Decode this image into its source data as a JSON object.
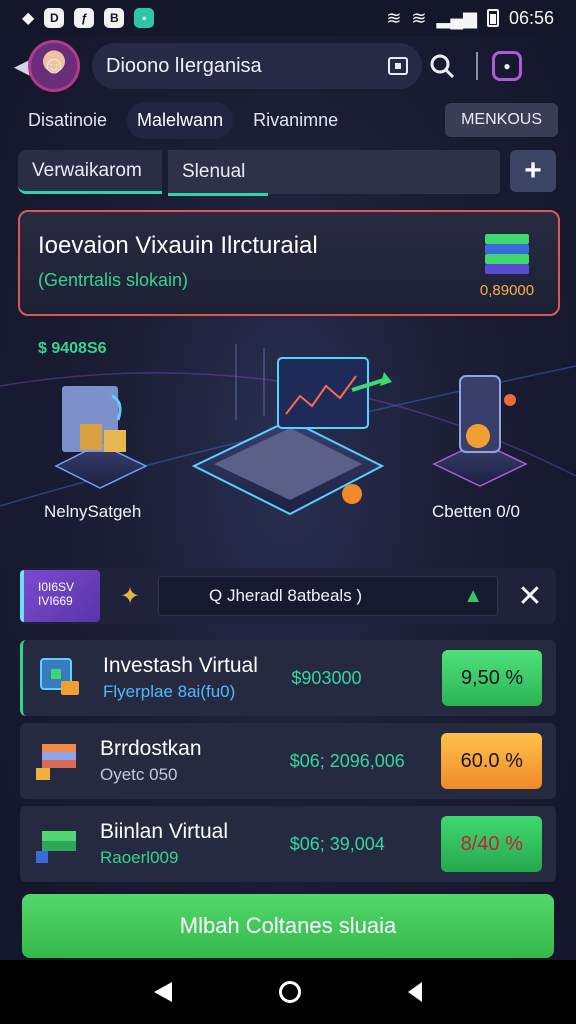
{
  "status_bar": {
    "time": "06:56",
    "icons": [
      "notification-icon",
      "app-icon-1",
      "app-icon-2",
      "app-icon-3",
      "gamepad-icon"
    ],
    "indicators": [
      "wifi-icon",
      "wifi-icon",
      "signal-icon",
      "battery-icon"
    ]
  },
  "header": {
    "title": "Dioono lIerganisa",
    "back_icon": "chevron-left-icon",
    "square_icon": "window-icon",
    "search_icon": "search-icon",
    "hex_icon": "shield-icon"
  },
  "tabs": {
    "items": [
      {
        "label": "Disatinoie"
      },
      {
        "label": "Malelwann"
      },
      {
        "label": "Rivanimne"
      }
    ],
    "menu_label": "MENKOUS"
  },
  "filters": {
    "left": "Verwaikarom",
    "right": "Slenual",
    "add_label": "+"
  },
  "hero": {
    "title": "Ioevaion Vixauin Ilrcturaial",
    "subtitle": "(Gentrtalis slokain)",
    "amount": "0,89000"
  },
  "illustration": {
    "amount": "$ 9408S6",
    "caption_left": "NelnySatgeh",
    "caption_right": "Cbetten 0/0"
  },
  "notice": {
    "tag_line1": "I0I6SV",
    "tag_line2": "IVI669",
    "text": "Q Jheradl 8atbeals )"
  },
  "rows": [
    {
      "name": "Investash Virtual",
      "sub": "Flyerplae 8ai(fu0)",
      "sub_color": "#4fb8ff",
      "amount": "$903000",
      "pill": "9,50 %"
    },
    {
      "name": "Brrdostkan",
      "sub": "Oyetc 050",
      "sub_color": "#c4c8d8",
      "amount": "$06; 2096,006",
      "pill": "60.0 %"
    },
    {
      "name": "Biinlan Virtual",
      "sub": "Raoerl009",
      "sub_color": "#35d48d",
      "amount": "$06; 39,004",
      "pill": "8/40 %"
    }
  ],
  "cta": {
    "label": "Mlbah Coltanes sluaia"
  },
  "colors": {
    "accent_green": "#35d48d",
    "hero_border": "#d95a55",
    "cta": "#3fc85a",
    "background": "#1a1d33"
  }
}
